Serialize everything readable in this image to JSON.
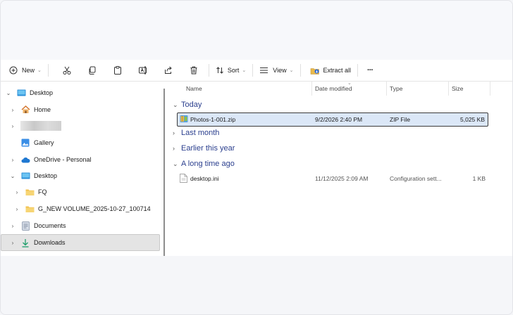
{
  "toolbar": {
    "new_label": "New",
    "sort_label": "Sort",
    "view_label": "View",
    "extract_label": "Extract all",
    "more_label": "···",
    "icons": [
      "plus-circle-icon",
      "cut-icon",
      "copy-icon",
      "paste-icon",
      "rename-icon",
      "share-icon",
      "delete-icon",
      "sort-icon",
      "view-icon",
      "extract-icon"
    ]
  },
  "nav": {
    "items": [
      {
        "label": "Desktop",
        "icon": "desktop-icon",
        "expander": "v"
      },
      {
        "label": "Home",
        "icon": "home-icon",
        "expander": ">"
      },
      {
        "label": "",
        "icon": "blurred-item",
        "expander": ">"
      },
      {
        "label": "Gallery",
        "icon": "gallery-icon",
        "expander": ""
      },
      {
        "label": "OneDrive - Personal",
        "icon": "cloud-icon",
        "expander": ">"
      },
      {
        "label": "Desktop",
        "icon": "desktop-icon",
        "expander": "v"
      },
      {
        "label": "FQ",
        "icon": "folder-icon",
        "expander": ">"
      },
      {
        "label": "G_NEW VOLUME_2025-10-27_100714",
        "icon": "folder-icon",
        "expander": ">"
      },
      {
        "label": "Documents",
        "icon": "documents-icon",
        "expander": ">"
      },
      {
        "label": "Downloads",
        "icon": "downloads-icon",
        "expander": ">"
      }
    ]
  },
  "columns": {
    "name": "Name",
    "date": "Date modified",
    "type": "Type",
    "size": "Size"
  },
  "groups": {
    "today": "Today",
    "last_month": "Last month",
    "earlier_year": "Earlier this year",
    "long_ago": "A long time ago"
  },
  "files": [
    {
      "name": "Photos-1-001.zip",
      "date": "9/2/2026 2:40 PM",
      "type": "ZIP File",
      "size": "5,025 KB",
      "icon": "zip-icon",
      "selected": true
    },
    {
      "name": "desktop.ini",
      "date": "11/12/2025 2:09 AM",
      "type": "Configuration sett...",
      "size": "1 KB",
      "icon": "ini-file-icon",
      "selected": false
    }
  ],
  "colors": {
    "accent": "#2b3f8e",
    "selection": "#dbe7f7",
    "nav_selection": "#e4e4e4"
  }
}
